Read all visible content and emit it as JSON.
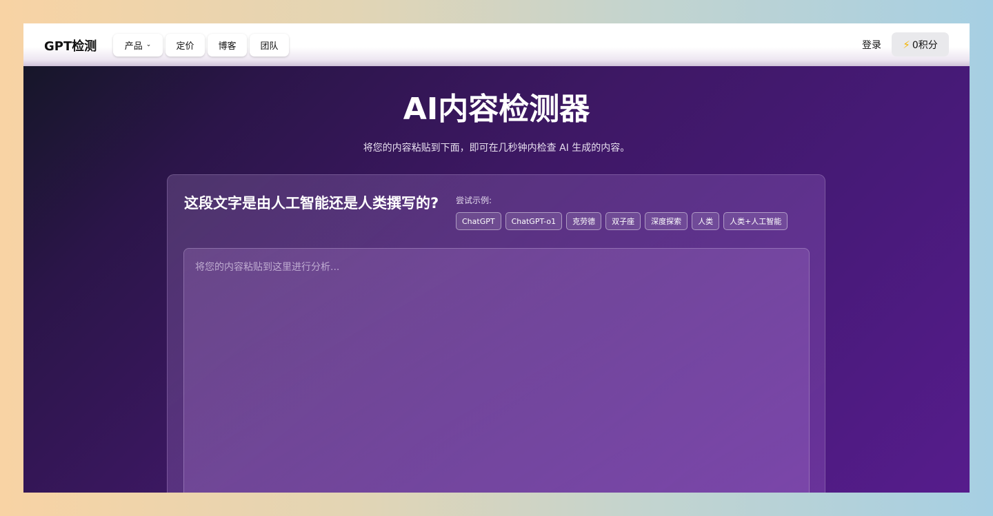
{
  "header": {
    "logo": "GPT检测",
    "nav": [
      {
        "label": "产品",
        "has_dropdown": true,
        "icon": "chevron-down-icon"
      },
      {
        "label": "定价"
      },
      {
        "label": "博客"
      },
      {
        "label": "团队"
      }
    ],
    "login_label": "登录",
    "points": {
      "icon": "lightning-icon",
      "label": "0积分"
    }
  },
  "hero": {
    "title": "AI内容检测器",
    "subtitle": "将您的内容粘贴到下面，即可在几秒钟内检查 AI 生成的内容。"
  },
  "detector": {
    "question": "这段文字是由人工智能还是人类撰写的?",
    "try_label": "尝试示例:",
    "examples": [
      "ChatGPT",
      "ChatGPT-o1",
      "克劳德",
      "双子座",
      "深度探索",
      "人类",
      "人类+人工智能"
    ],
    "input_placeholder": "将您的内容粘贴到这里进行分析...",
    "input_value": ""
  },
  "colors": {
    "accent_bolt": "#f4b400",
    "hero_bg_start": "#161629",
    "hero_bg_end": "#561c8c"
  }
}
